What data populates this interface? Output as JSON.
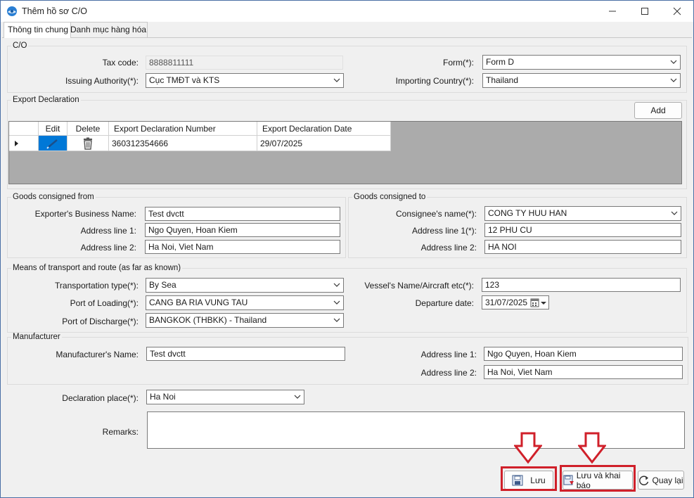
{
  "window": {
    "title": "Thêm hồ sơ C/O",
    "minimize": "—",
    "maximize": "☐",
    "close": "✕"
  },
  "tabs": [
    {
      "label": "Thông tin chung"
    },
    {
      "label": "Danh mục hàng hóa"
    }
  ],
  "co": {
    "legend": "C/O",
    "tax_code_label": "Tax code:",
    "tax_code": "8888811111",
    "issuing_label": "Issuing Authority(*):",
    "issuing": "Cục TMĐT và KTS",
    "form_label": "Form(*):",
    "form": "Form D",
    "importing_label": "Importing Country(*):",
    "importing": "Thailand"
  },
  "export": {
    "legend": "Export Declaration",
    "add_label": "Add",
    "columns": {
      "edit": "Edit",
      "delete": "Delete",
      "number": "Export Declaration Number",
      "date": "Export Declaration Date"
    },
    "rows": [
      {
        "number": "360312354666",
        "date": "29/07/2025"
      }
    ]
  },
  "from": {
    "legend": "Goods consigned from",
    "exporter_label": "Exporter's Business Name:",
    "exporter": "Test dvctt",
    "addr1_label": "Address line 1:",
    "addr1": "Ngo Quyen, Hoan Kiem",
    "addr2_label": "Address line 2:",
    "addr2": "Ha Noi, Viet Nam"
  },
  "to": {
    "legend": "Goods consigned to",
    "consignee_label": "Consignee's name(*):",
    "consignee": "CONG TY HUU HAN",
    "addr1_label": "Address line 1(*):",
    "addr1": "12 PHU CU",
    "addr2_label": "Address line 2:",
    "addr2": "HA NOI"
  },
  "transport": {
    "legend": "Means of transport and route (as far as known)",
    "type_label": "Transportation type(*):",
    "type": "By Sea",
    "loading_label": "Port of Loading(*):",
    "loading": "CANG BA RIA VUNG TAU",
    "discharge_label": "Port of Discharge(*):",
    "discharge": "BANGKOK (THBKK) - Thailand",
    "vessel_label": "Vessel's Name/Aircraft etc(*):",
    "vessel": "123",
    "departure_label": "Departure date:",
    "departure": "31/07/2025"
  },
  "manufacturer": {
    "legend": "Manufacturer",
    "name_label": "Manufacturer's Name:",
    "name": "Test dvctt",
    "addr1_label": "Address line 1:",
    "addr1": "Ngo Quyen, Hoan Kiem",
    "addr2_label": "Address line 2:",
    "addr2": "Ha Noi, Viet Nam"
  },
  "declaration_place_label": "Declaration place(*):",
  "declaration_place": "Ha Noi",
  "remarks_label": "Remarks:",
  "remarks": "",
  "buttons": {
    "save": "Lưu",
    "save_declare": "Lưu và khai báo",
    "back": "Quay lại"
  },
  "colors": {
    "highlight": "#d0202a",
    "selected_cell": "#0078d7",
    "grid_bg": "#ababab"
  }
}
